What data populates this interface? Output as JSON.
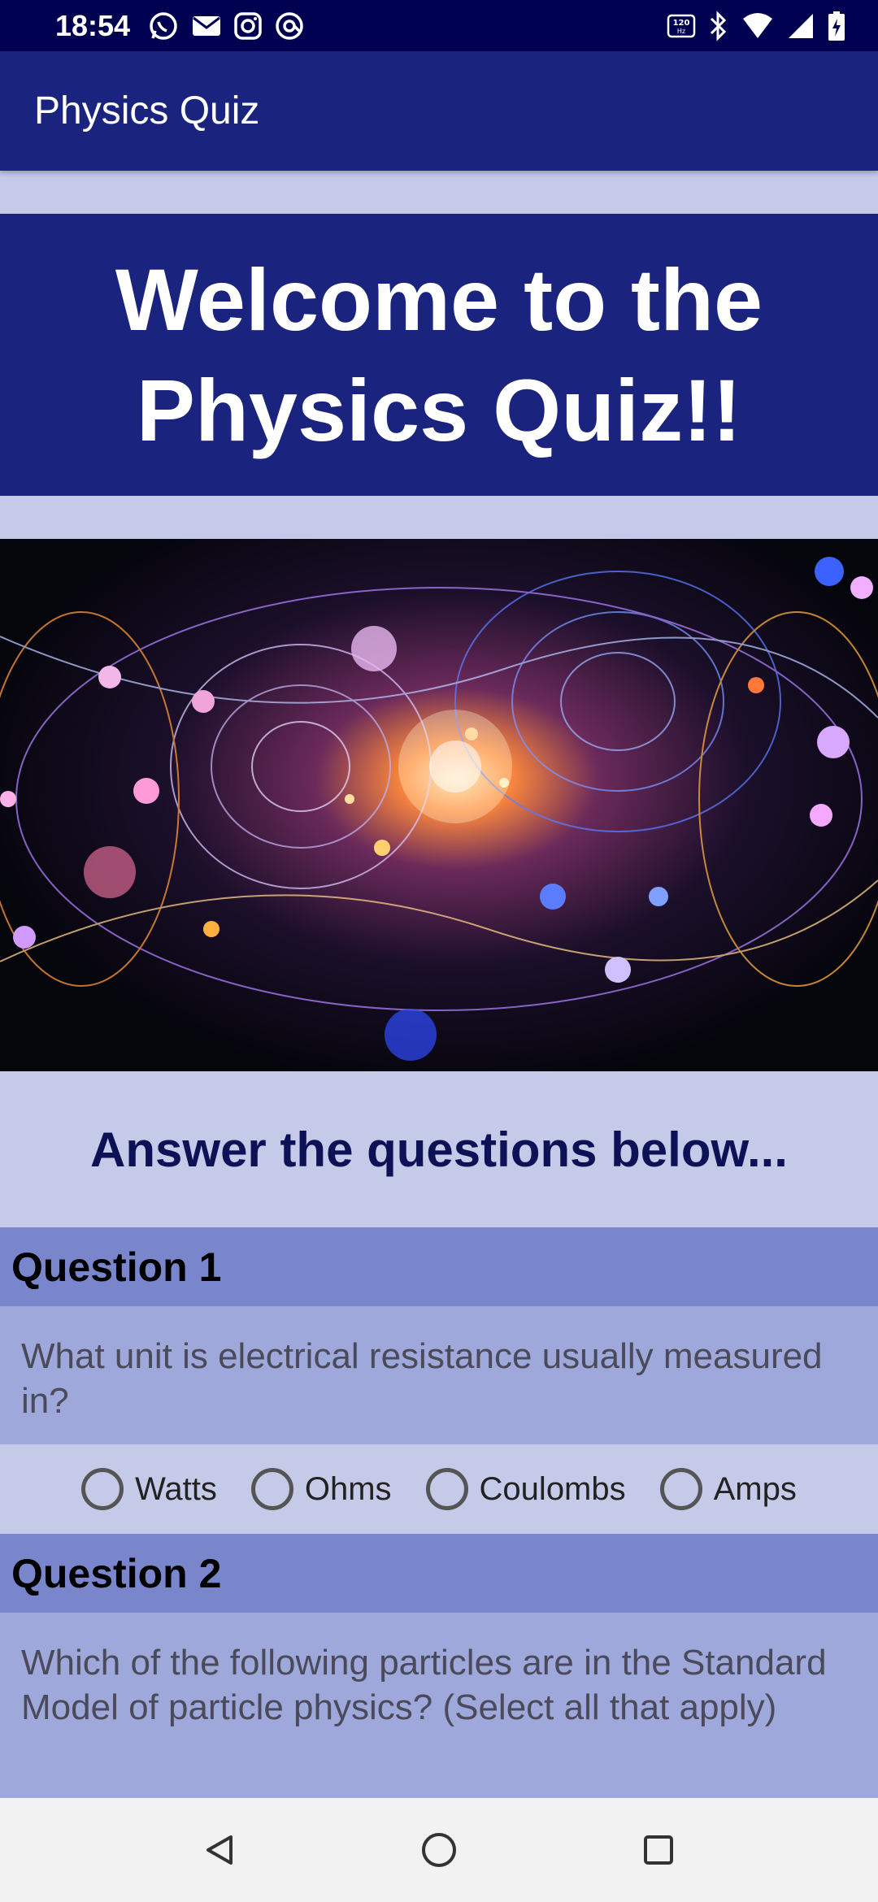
{
  "status_bar": {
    "time": "18:54",
    "left_icons": [
      "whatsapp-icon",
      "mail-icon",
      "instagram-icon",
      "sync-icon"
    ],
    "right_icons": [
      "refresh-rate-120hz-icon",
      "bluetooth-icon",
      "wifi-icon",
      "signal-icon",
      "battery-charging-icon"
    ],
    "hz_label": "120Hz"
  },
  "app_bar": {
    "title": "Physics Quiz"
  },
  "welcome": {
    "title": "Welcome to the Physics Quiz!!"
  },
  "instruction": "Answer the questions below...",
  "questions": [
    {
      "header": "Question 1",
      "text": "What unit is electrical resistance usually measured in?",
      "options": [
        "Watts",
        "Ohms",
        "Coulombs",
        "Amps"
      ]
    },
    {
      "header": "Question 2",
      "text": "Which of the following particles are in the Standard Model of particle physics? (Select all that apply)"
    }
  ],
  "colors": {
    "status_bar": "#000051",
    "primary": "#1a237e",
    "background": "#c5cae9",
    "question_header": "#7986cb",
    "question_body": "#9fa8da",
    "instruction_text": "#0d1257"
  },
  "nav_bar": {
    "icons": [
      "back-icon",
      "home-icon",
      "recents-icon"
    ]
  }
}
